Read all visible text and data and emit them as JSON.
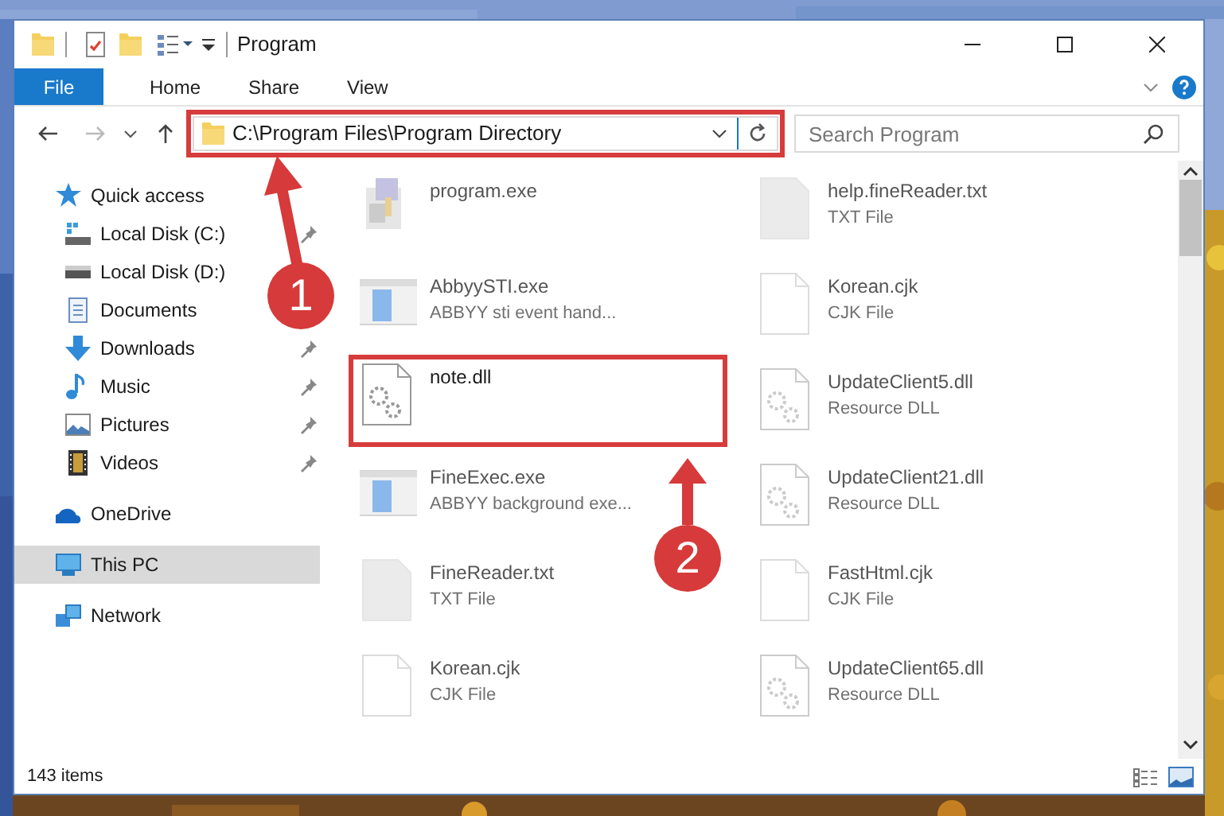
{
  "window": {
    "title": "Program"
  },
  "ribbon": {
    "tabs": [
      {
        "label": "File",
        "kind": "file"
      },
      {
        "label": "Home",
        "kind": "tab"
      },
      {
        "label": "Share",
        "kind": "tab"
      },
      {
        "label": "View",
        "kind": "tab"
      }
    ]
  },
  "address_bar": {
    "path": "C:\\Program Files\\Program Directory",
    "highlighted": true
  },
  "search": {
    "placeholder": "Search Program"
  },
  "sidebar": {
    "items": [
      {
        "label": "Quick access",
        "kind": "quick",
        "selected": false,
        "children": [
          {
            "label": "Local Disk (C:)",
            "kind": "drive-c",
            "pinned": true,
            "selected": false
          },
          {
            "label": "Local Disk (D:)",
            "kind": "drive",
            "selected": false
          },
          {
            "label": "Documents",
            "kind": "documents",
            "selected": false
          },
          {
            "label": "Downloads",
            "kind": "downloads",
            "pinned": true,
            "selected": false
          },
          {
            "label": "Music",
            "kind": "music",
            "pinned": true,
            "selected": false
          },
          {
            "label": "Pictures",
            "kind": "pictures",
            "pinned": true,
            "selected": false
          },
          {
            "label": "Videos",
            "kind": "videos",
            "pinned": true,
            "selected": false
          }
        ]
      },
      {
        "label": "OneDrive",
        "kind": "onedrive",
        "selected": false
      },
      {
        "label": "This PC",
        "kind": "pc",
        "selected": true
      },
      {
        "label": "Network",
        "kind": "network",
        "selected": false
      }
    ]
  },
  "files": [
    {
      "name": "program.exe",
      "kind": "exe",
      "faded": true,
      "highlighted": false
    },
    {
      "name": "help.fineReader.txt",
      "type": "TXT File",
      "kind": "txt",
      "faded": true,
      "highlighted": false
    },
    {
      "name": "AbbyySTI.exe",
      "type": "ABBYY sti event hand...",
      "kind": "app",
      "faded": true,
      "highlighted": false
    },
    {
      "name": "Korean.cjk",
      "type": "CJK File",
      "kind": "page",
      "faded": true,
      "highlighted": false
    },
    {
      "name": "note.dll",
      "kind": "dll",
      "faded": false,
      "highlighted": true
    },
    {
      "name": "UpdateClient5.dll",
      "type": "Resource DLL",
      "kind": "dll",
      "faded": true,
      "highlighted": false
    },
    {
      "name": "FineExec.exe",
      "type": "ABBYY background exe...",
      "kind": "app",
      "faded": true,
      "highlighted": false
    },
    {
      "name": "UpdateClient21.dll",
      "type": "Resource DLL",
      "kind": "dll",
      "faded": true,
      "highlighted": false
    },
    {
      "name": "FineReader.txt",
      "type": "TXT File",
      "kind": "txt",
      "faded": true,
      "highlighted": false
    },
    {
      "name": "FastHtml.cjk",
      "type": "CJK File",
      "kind": "page",
      "faded": true,
      "highlighted": false
    },
    {
      "name": "Korean.cjk",
      "type": "CJK File",
      "kind": "page",
      "faded": true,
      "highlighted": false
    },
    {
      "name": "UpdateClient65.dll",
      "type": "Resource DLL",
      "kind": "dll",
      "faded": true,
      "highlighted": false
    }
  ],
  "status_bar": {
    "item_count": "143 items"
  },
  "annotations": [
    {
      "label": "1"
    },
    {
      "label": "2"
    }
  ]
}
